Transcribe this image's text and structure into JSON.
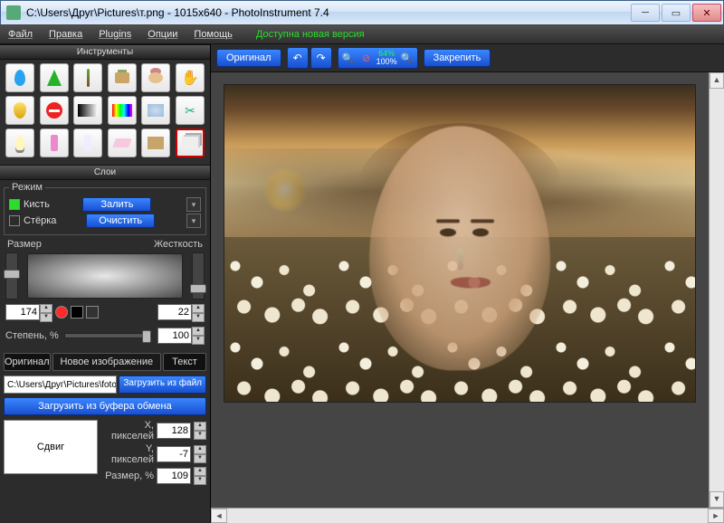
{
  "title": "C:\\Users\\Друг\\Pictures\\т.png - 1015x640 - PhotoInstrument 7.4",
  "menu": {
    "file": "Файл",
    "edit": "Правка",
    "plugins": "Plugins",
    "options": "Опции",
    "help": "Помощь",
    "update": "Доступна новая версия"
  },
  "panels": {
    "tools": "Инструменты",
    "layers": "Слои"
  },
  "mode": {
    "legend": "Режим",
    "brush": "Кисть",
    "eraser": "Стёрка",
    "fill": "Залить",
    "clear": "Очистить",
    "brush_on": true,
    "eraser_on": false
  },
  "sliders": {
    "size_label": "Размер",
    "size_value": "174",
    "hardness_label": "Жесткость",
    "hardness_value": "22",
    "degree_label": "Степень, %",
    "degree_value": "100"
  },
  "swatches": {
    "fg": "#ff0000",
    "bg": "#000000"
  },
  "tabs": {
    "original": "Оригинал",
    "newimage": "Новое изображение",
    "text": "Текст"
  },
  "file": {
    "combo": "C:\\Users\\Друг\\Pictures\\foto na ",
    "load_file": "Загрузить из файл",
    "load_clip": "Загрузить из буфера обмена"
  },
  "shift": {
    "btn": "Сдвиг",
    "x_label": "X, пикселей",
    "x_val": "128",
    "y_label": "Y, пикселей",
    "y_val": "-7",
    "size_label": "Размер, %",
    "size_val": "109"
  },
  "toolbar": {
    "original": "Оригинал",
    "pin": "Закрепить",
    "zoom_top": "64%",
    "zoom_bottom": "100%"
  },
  "tools": [
    [
      "drop",
      "cone",
      "brush",
      "stamp",
      "smudge",
      "hand"
    ],
    [
      "shield",
      "noentry",
      "grad-bw",
      "grad-rainbow",
      "blur",
      "scissors"
    ],
    [
      "bulb",
      "bottle",
      "cfl",
      "eraser",
      "package",
      "layers"
    ]
  ],
  "selected_tool": "layers"
}
